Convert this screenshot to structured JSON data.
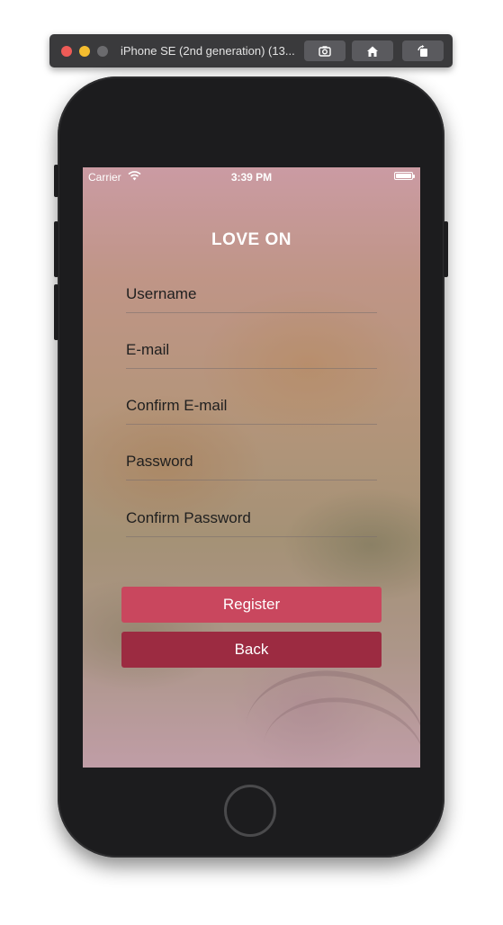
{
  "simulator": {
    "title": "iPhone SE (2nd generation) (13...",
    "buttons": [
      "screenshot-icon",
      "home-icon",
      "rotate-icon"
    ]
  },
  "status_bar": {
    "carrier": "Carrier",
    "time": "3:39 PM"
  },
  "app": {
    "title": "LOVE ON",
    "fields": [
      {
        "placeholder": "Username"
      },
      {
        "placeholder": "E-mail"
      },
      {
        "placeholder": "Confirm E-mail"
      },
      {
        "placeholder": "Password"
      },
      {
        "placeholder": "Confirm Password"
      }
    ],
    "register_label": "Register",
    "back_label": "Back"
  },
  "colors": {
    "register_bg": "#c9475e",
    "back_bg": "#9c2b41",
    "title_color": "#ffffff",
    "tint": "#cd8c9b"
  }
}
